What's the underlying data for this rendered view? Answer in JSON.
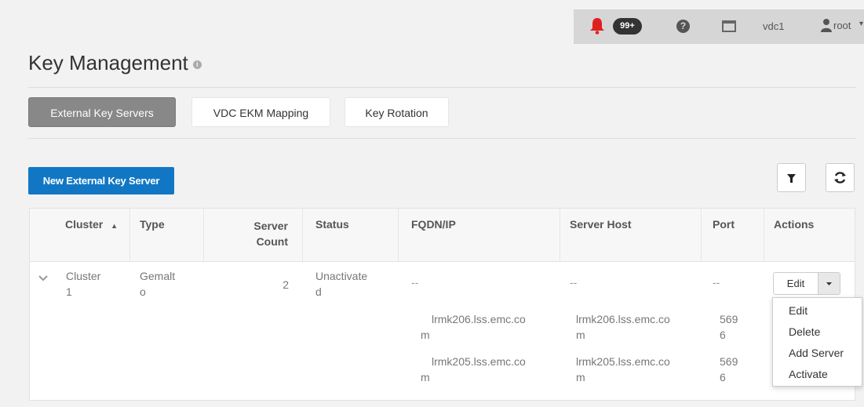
{
  "header": {
    "notification_count": "99+",
    "vdc": "vdc1",
    "user": "root",
    "icons": [
      "bell-icon",
      "help-icon",
      "window-icon",
      "user-icon",
      "caret-down-icon"
    ],
    "alert_color": "#e02020"
  },
  "page": {
    "title": "Key Management"
  },
  "tabs": [
    {
      "label": "External Key Servers",
      "active": true
    },
    {
      "label": "VDC EKM Mapping",
      "active": false
    },
    {
      "label": "Key Rotation",
      "active": false
    }
  ],
  "toolbar": {
    "new_button": "New External Key Server",
    "icons": [
      "filter-icon",
      "refresh-icon"
    ],
    "accent": "#1177c4"
  },
  "table": {
    "columns": {
      "cluster": "Cluster",
      "type": "Type",
      "server_count_1": "Server",
      "server_count_2": "Count",
      "status": "Status",
      "fqdn": "FQDN/IP",
      "server_host": "Server Host",
      "port": "Port",
      "actions": "Actions"
    },
    "sort": {
      "column": "Cluster",
      "direction": "ascending"
    },
    "row": {
      "cluster_1": "Cluster",
      "cluster_2": "1",
      "type_1": "Gemalt",
      "type_2": "o",
      "server_count": "2",
      "status_1": "Unactivate",
      "status_2": "d",
      "fqdn": "--",
      "server_host": "--",
      "port": "--",
      "edit_label": "Edit"
    },
    "subrows": [
      {
        "fqdn_1": "lrmk206.lss.emc.co",
        "fqdn_2": "m",
        "host_1": "lrmk206.lss.emc.co",
        "host_2": "m",
        "port_1": "569",
        "port_2": "6"
      },
      {
        "fqdn_1": "lrmk205.lss.emc.co",
        "fqdn_2": "m",
        "host_1": "lrmk205.lss.emc.co",
        "host_2": "m",
        "port_1": "569",
        "port_2": "6"
      }
    ]
  },
  "actions_menu": {
    "items": [
      "Edit",
      "Delete",
      "Add Server",
      "Activate"
    ]
  }
}
